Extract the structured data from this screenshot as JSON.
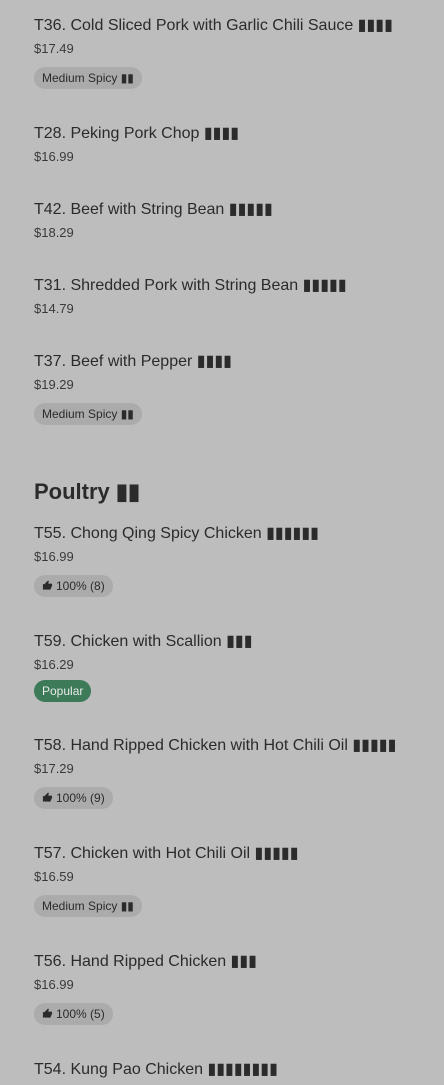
{
  "section": {
    "title": "Poultry ▮▮"
  },
  "items": [
    {
      "name": "T36. Cold Sliced Pork with Garlic Chili Sauce ▮▮▮▮",
      "price": "$17.49",
      "badge": "Medium Spicy ▮▮"
    },
    {
      "name": "T28. Peking Pork Chop ▮▮▮▮",
      "price": "$16.99"
    },
    {
      "name": "T42. Beef with String Bean ▮▮▮▮▮",
      "price": "$18.29"
    },
    {
      "name": "T31. Shredded Pork with String Bean ▮▮▮▮▮",
      "price": "$14.79"
    },
    {
      "name": "T37. Beef with Pepper ▮▮▮▮",
      "price": "$19.29",
      "badge": "Medium Spicy ▮▮"
    },
    {
      "name": "T55. Chong Qing Spicy Chicken ▮▮▮▮▮▮",
      "price": "$16.99",
      "rating": "100% (8)"
    },
    {
      "name": "T59. Chicken with Scallion ▮▮▮",
      "price": "$16.29",
      "popular": "Popular"
    },
    {
      "name": "T58. Hand Ripped Chicken with Hot Chili Oil ▮▮▮▮▮",
      "price": "$17.29",
      "rating": "100% (9)"
    },
    {
      "name": "T57. Chicken with Hot Chili Oil ▮▮▮▮▮",
      "price": "$16.59",
      "badge": "Medium Spicy ▮▮"
    },
    {
      "name": "T56. Hand Ripped Chicken ▮▮▮",
      "price": "$16.99",
      "rating": "100% (5)"
    },
    {
      "name": "T54. Kung Pao Chicken ▮▮▮▮▮▮▮▮"
    }
  ],
  "icons": {
    "thumb": "thumbs-up-icon"
  },
  "colors": {
    "background": "#bdbdbd",
    "popular_badge": "#3c7a58",
    "tag": "#ababab"
  }
}
